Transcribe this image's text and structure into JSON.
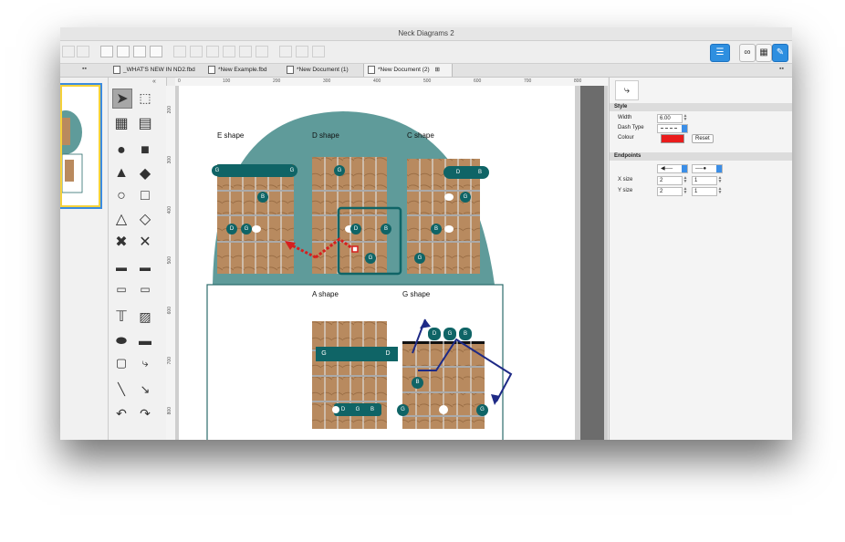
{
  "window": {
    "title": "Neck Diagrams 2"
  },
  "tabs": [
    {
      "label": "_WHAT'S NEW IN ND2.fbd"
    },
    {
      "label": "*New Example.fbd"
    },
    {
      "label": "*New Document (1)"
    },
    {
      "label": "*New Document (2)"
    }
  ],
  "ruler": {
    "horizontal": [
      "0",
      "100",
      "200",
      "300",
      "400",
      "500",
      "600",
      "700",
      "800"
    ],
    "vertical": [
      "200",
      "300",
      "400",
      "500",
      "600",
      "700",
      "800"
    ]
  },
  "diagram": {
    "shapes_top": [
      "E shape",
      "D shape",
      "C shape"
    ],
    "shapes_bottom": [
      "A shape",
      "G shape"
    ],
    "e_shape": {
      "bar_left": "G",
      "bar_right": "G",
      "n1": "B",
      "n2": "D",
      "n3": "G"
    },
    "d_shape": {
      "top": "G",
      "n1": "D",
      "n2": "B",
      "n3": "G"
    },
    "c_shape": {
      "bar_left": "D",
      "bar_right": "B",
      "n1": "G",
      "n2": "B",
      "n3": "G"
    },
    "a_shape": {
      "bar_left": "G",
      "bar_right": "D",
      "n1": "D",
      "n2": "G",
      "n3": "B"
    },
    "g_shape": {
      "t1": "D",
      "t2": "G",
      "t3": "B",
      "n1": "B",
      "n2": "G",
      "n3": "G"
    }
  },
  "inspector": {
    "style_header": "Style",
    "width_label": "Width",
    "width_value": "6.00",
    "dash_label": "Dash Type",
    "colour_label": "Colour",
    "colour_value": "#ea1c1c",
    "reset_label": "Reset",
    "endpoints_header": "Endpoints",
    "xsize_label": "X size",
    "xsize_left": "2",
    "xsize_right": "1",
    "ysize_label": "Y size",
    "ysize_left": "2",
    "ysize_right": "1"
  },
  "colors": {
    "teal": "#5f9b9a",
    "note": "#0f6466",
    "red_line": "#d61f1f",
    "navy_line": "#1e2a86",
    "accent": "#2e8fe0"
  }
}
